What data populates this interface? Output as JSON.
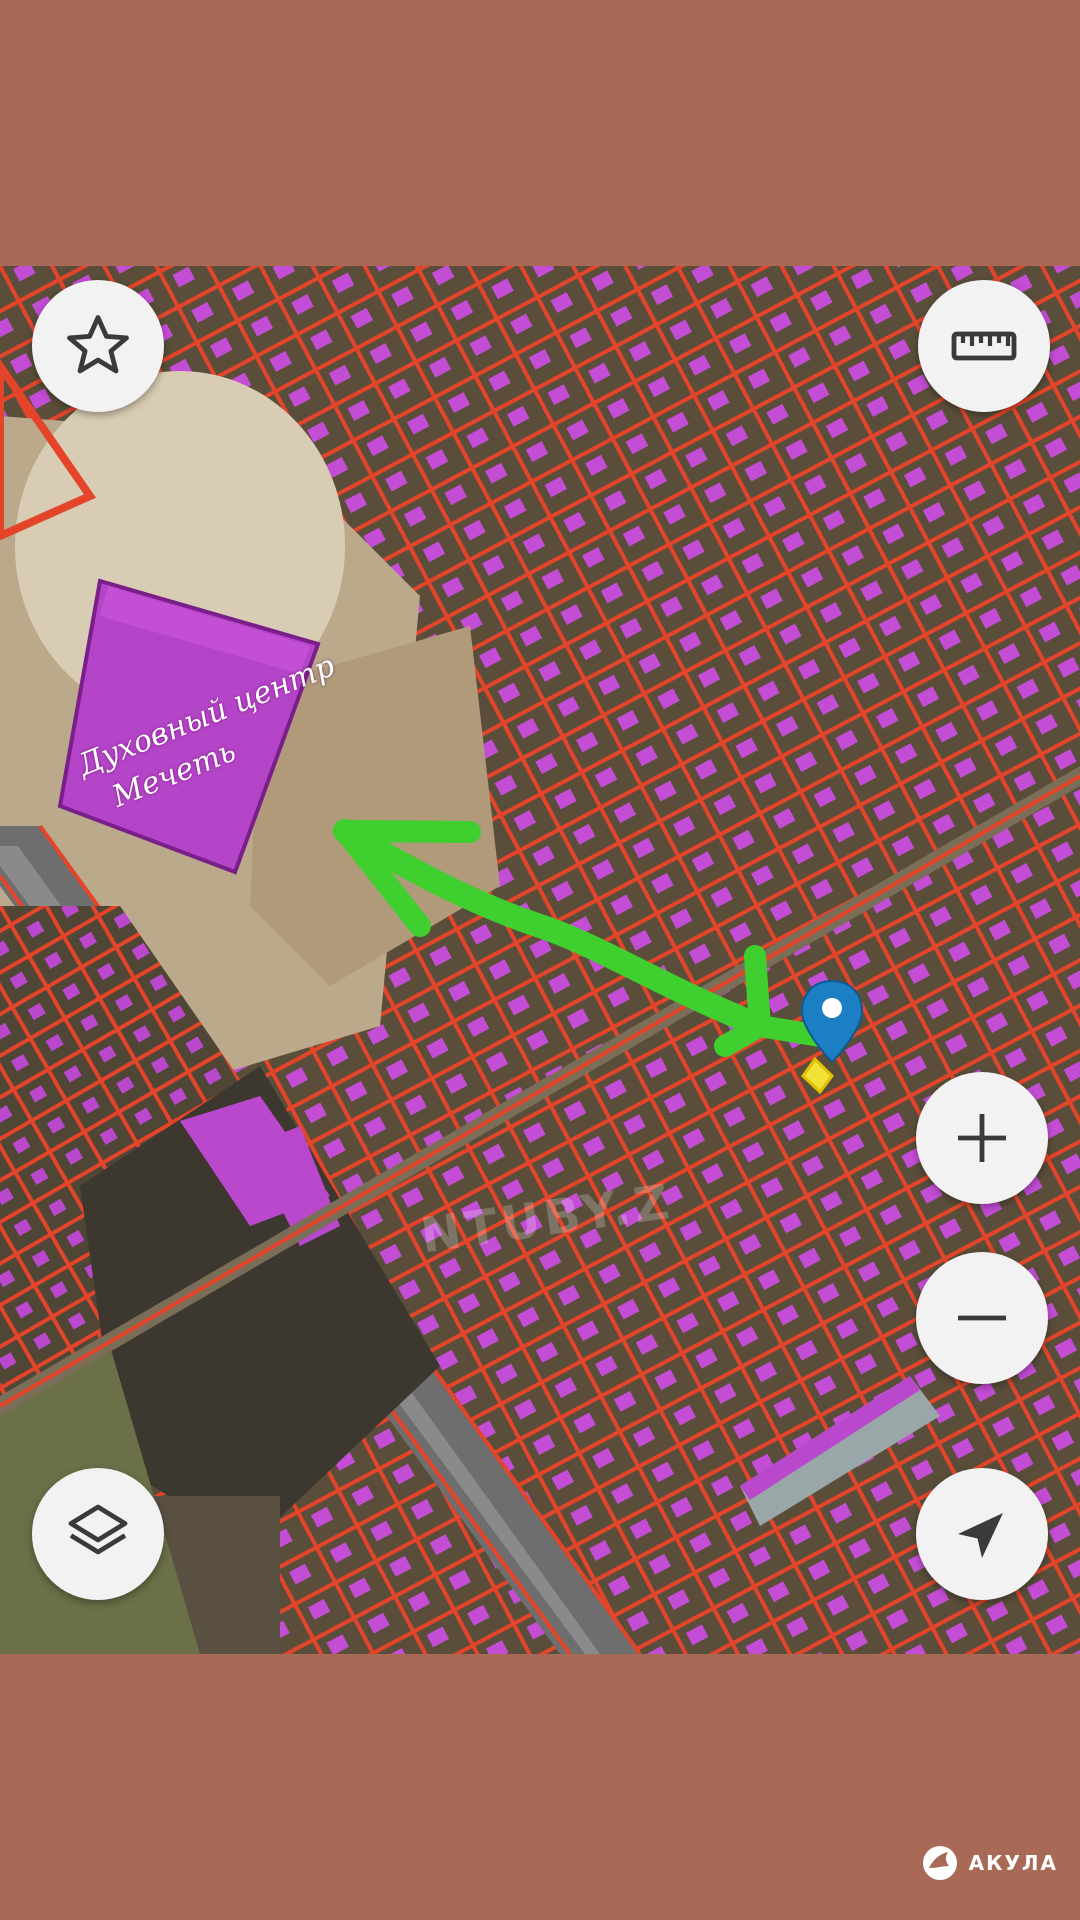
{
  "map": {
    "place_label_line1": "Духовный центр",
    "place_label_line2": "Мечеть",
    "watermark": "NTUBY.Z",
    "marker_color": "#1c7fc4",
    "parcel_outline_color": "#e4452a",
    "building_fill_color": "#c44dd6",
    "arrow_color": "#3fcf2e"
  },
  "controls": {
    "favorite": "star-icon",
    "ruler": "ruler-icon",
    "zoom_in": "plus-icon",
    "zoom_out": "minus-icon",
    "layers": "layers-icon",
    "my_location": "navigation-arrow-icon"
  },
  "brand": {
    "name": "АКУЛА",
    "icon": "shark-logo-icon"
  }
}
